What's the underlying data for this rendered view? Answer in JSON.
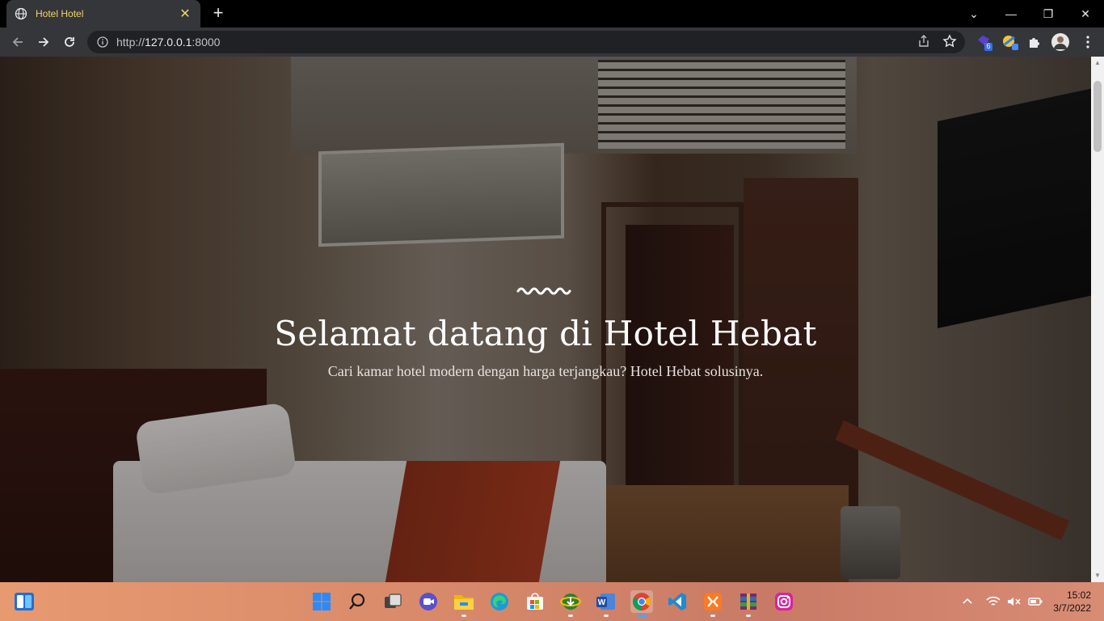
{
  "browser": {
    "tab_title": "Hotel Hotel",
    "tab_close": "✕",
    "new_tab": "+",
    "url_prefix": "http://",
    "url_host": "127.0.0.1",
    "url_suffix": ":8000",
    "window_controls": [
      "⌄",
      "—",
      "❐",
      "✕"
    ],
    "extension_badge": "6"
  },
  "hero": {
    "heading": "Selamat datang di Hotel Hebat",
    "subtitle": "Cari kamar hotel modern dengan harga terjangkau? Hotel Hebat solusinya."
  },
  "taskbar": {
    "apps": [
      "start",
      "search",
      "task-view",
      "meet",
      "file-explorer",
      "edge",
      "store",
      "idm",
      "word",
      "chrome",
      "vscode",
      "xampp",
      "winrar",
      "instagram"
    ],
    "time": "15:02",
    "date": "3/7/2022"
  },
  "colors": {
    "tab_text": "#f1d46b",
    "toolbar": "#35363a",
    "omnibox": "#202124"
  }
}
